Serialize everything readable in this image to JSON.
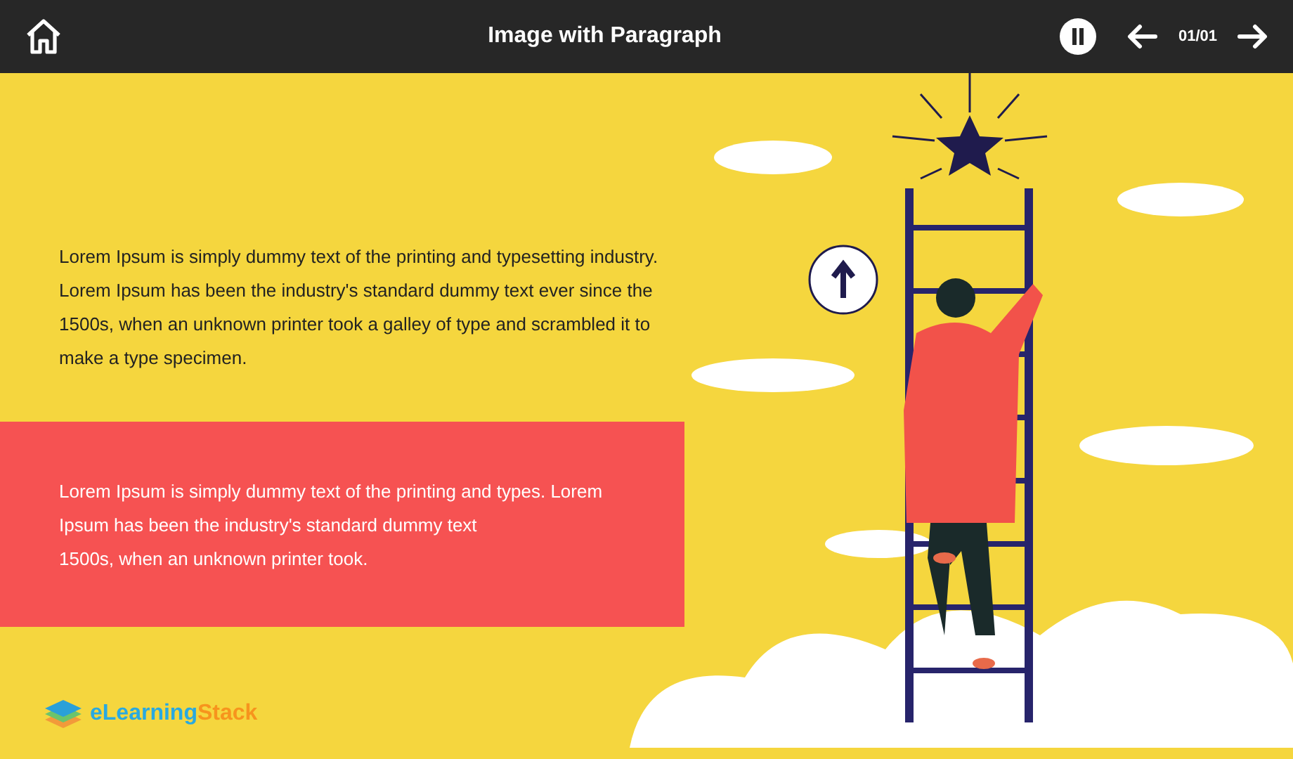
{
  "header": {
    "title": "Image with Paragraph",
    "page_counter": "01/01",
    "playing": true
  },
  "paragraphs": [
    {
      "kind": "plain",
      "lines": [
        "Lorem Ipsum is simply dummy text of the printing and typesetting industry.",
        "Lorem Ipsum has been the industry's standard dummy text ever since the",
        "1500s, when an unknown printer took a galley of type and scrambled it to",
        "make a type specimen."
      ]
    },
    {
      "kind": "highlight",
      "lines": [
        "Lorem Ipsum is simply dummy text of the printing and types. Lorem",
        "Ipsum has been the industry's standard dummy text",
        "1500s, when an unknown printer took."
      ]
    }
  ],
  "logo": {
    "part_1": "eLearning",
    "part_2": "Stack"
  }
}
